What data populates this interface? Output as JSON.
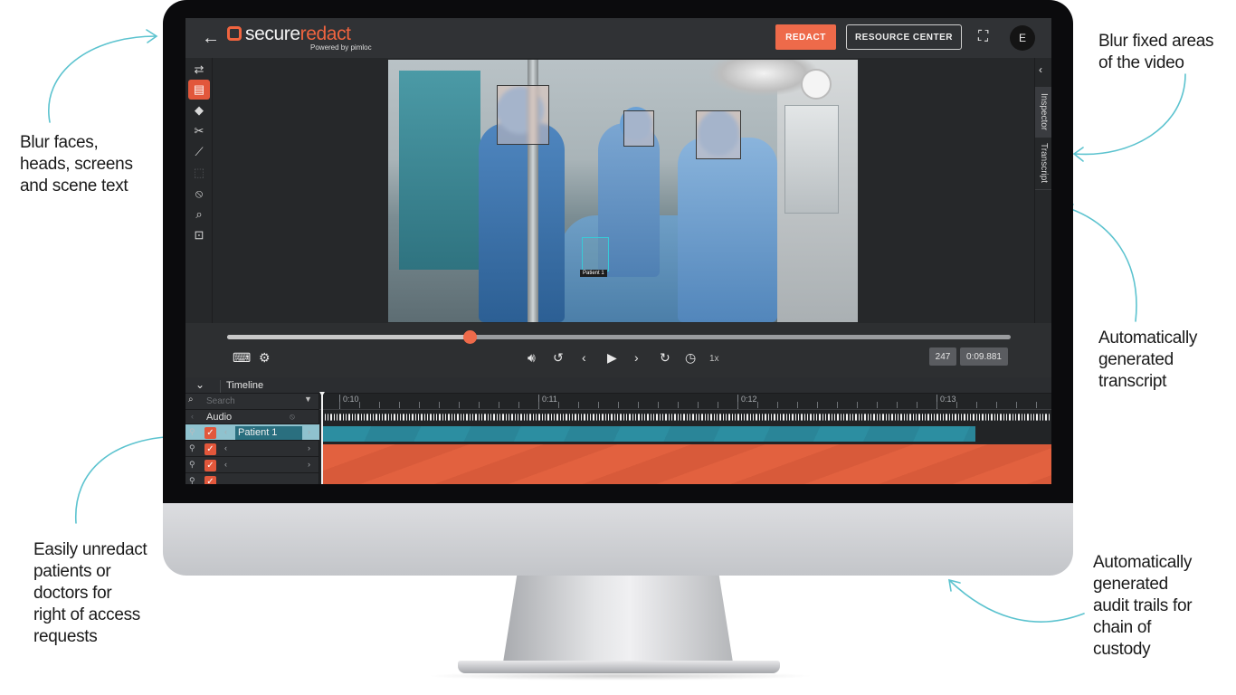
{
  "callouts": {
    "blur_faces": [
      "Blur faces,",
      "heads, screens",
      "and scene text"
    ],
    "blur_fixed": [
      "Blur fixed areas",
      "of the video"
    ],
    "transcript": [
      "Automatically",
      "generated",
      "transcript"
    ],
    "unredact": [
      "Easily unredact",
      "patients or",
      "doctors for",
      "right of access",
      "requests"
    ],
    "audit": [
      "Automatically",
      "generated",
      "audit trails for",
      "chain of",
      "custody"
    ]
  },
  "app": {
    "logo_main": "secure",
    "logo_accent": "redact",
    "logo_sub": "Powered by pimloc",
    "redact_button": "REDACT",
    "resource_button": "RESOURCE CENTER",
    "avatar_initial": "E",
    "brand_color": "#ee6a4a"
  },
  "icons": {
    "back": "←",
    "fullscreen": "⛶",
    "chevron_left": "‹",
    "chevron_down": "⌄",
    "search": "🔍",
    "filter": "▼"
  },
  "toolbar_icons": [
    "swap-arrows-icon",
    "redaction-list-icon",
    "tag-icon",
    "scissors-icon",
    "motion-path-icon",
    "selection-box-icon",
    "ear-off-icon",
    "zoom-icon",
    "focus-frame-icon"
  ],
  "video": {
    "patient_label": "Patient 1"
  },
  "side_panel": {
    "tab_inspector": "Inspector",
    "tab_transcript": "Transcript"
  },
  "player": {
    "progress": 0.31,
    "speed": "1x",
    "frame": "247",
    "time": "0:09.881"
  },
  "timeline": {
    "title": "Timeline",
    "search_placeholder": "Search",
    "audio_label": "Audio",
    "ruler": [
      "0:10",
      "0:11",
      "0:12",
      "0:13"
    ],
    "tracks": [
      {
        "name": "Patient 1",
        "selected": true
      },
      {
        "name": "",
        "selected": false
      },
      {
        "name": "",
        "selected": false
      }
    ]
  }
}
